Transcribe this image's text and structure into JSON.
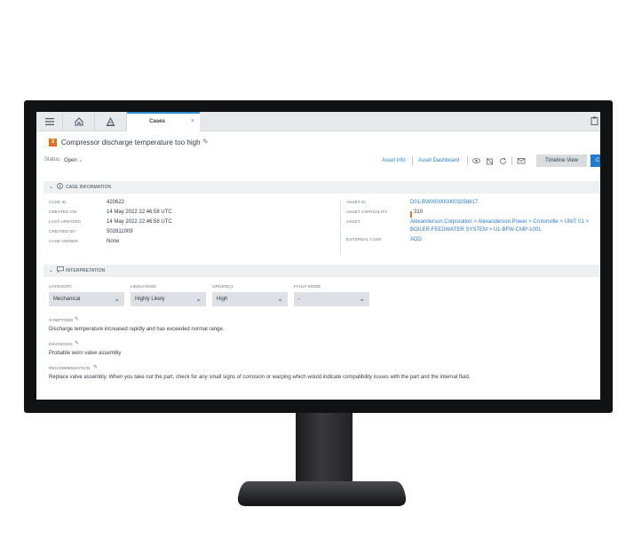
{
  "topbar": {
    "tab_label": "Cases",
    "tab_close": "×"
  },
  "case": {
    "badge": "3",
    "title": "Compressor discharge temperature too high",
    "status_label": "Status",
    "status_value": "Open",
    "status_chevron": "⌄"
  },
  "actions": {
    "asset_info": "Asset Info",
    "asset_dashboard": "Asset Dashboard",
    "timeline_view": "Timeline View",
    "primary_button": "C"
  },
  "case_information": {
    "header": "CASE INFORMATION",
    "left": [
      {
        "label": "CASE ID",
        "value": "420622"
      },
      {
        "label": "CREATED ON",
        "value": "14 May 2022 22:46:58 UTC"
      },
      {
        "label": "LAST UPDATED",
        "value": "14 May 2022 22:46:58 UTC"
      },
      {
        "label": "CREATED BY",
        "value": "502811009"
      },
      {
        "label": "CASE OWNER",
        "value": "None"
      }
    ],
    "right": {
      "asset_id_label": "ASSET ID",
      "asset_id_value": "D01-BW0000000003256817",
      "criticality_label": "ASSET CRITICALITY",
      "criticality_value": "310",
      "asset_label": "ASSET",
      "asset_path_1": "Alexanderson Corporation > Alexanderson Power > Crotonville > UNIT 01 >",
      "asset_path_2": "BOILER FEEDWATER SYSTEM > U1-BFW-CMP-1001",
      "external_case_label": "EXTERNAL CASE",
      "external_case_value": "ADD"
    }
  },
  "interpretation": {
    "header": "INTERPRETATION",
    "dropdowns": [
      {
        "label": "CATEGORY",
        "value": "Mechanical"
      },
      {
        "label": "LIKELIHOOD",
        "value": "Highly Likely"
      },
      {
        "label": "URGENCY",
        "value": "High"
      },
      {
        "label": "FAULT MODE",
        "value": "-"
      }
    ],
    "symptoms_label": "SYMPTOMS",
    "symptoms_value": "Discharge temperature increased rapidly and has exceeded normal range.",
    "diagnosis_label": "DIAGNOSIS",
    "diagnosis_value": "Probable worn valve assembly",
    "recommendation_label": "RECOMMENDATION",
    "recommendation_value": "Replace valve assembly. When you take out the part, check for any small signs of corrosion or warping which would indicate compatibility issues with the part and the internal fluid."
  },
  "colors": {
    "accent": "#1f7ad1",
    "link": "#2a7dc9",
    "badge": "#e0701e",
    "bezel": "#111214"
  }
}
